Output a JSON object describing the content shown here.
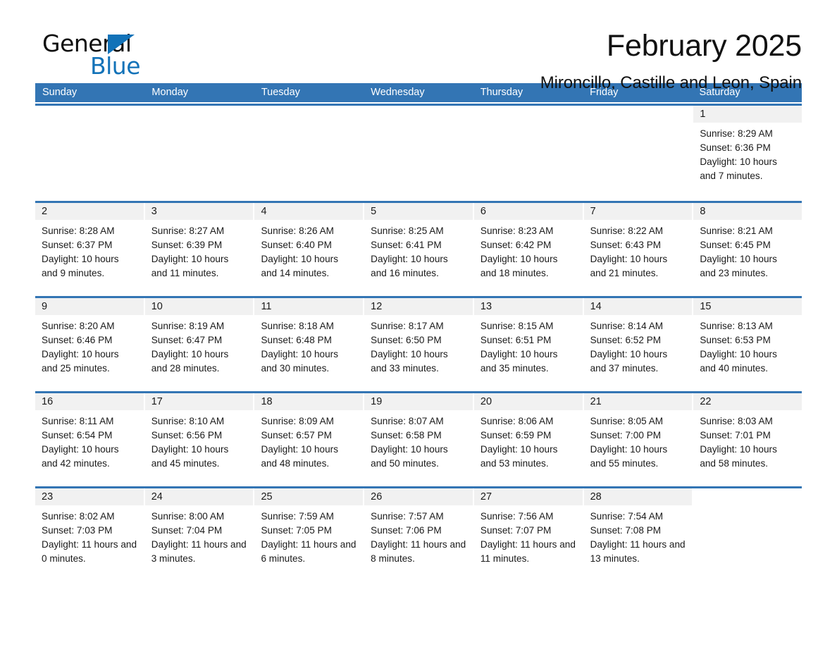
{
  "brand": {
    "name_part1": "General",
    "name_part2": "Blue",
    "accent_color": "#1272b8"
  },
  "header": {
    "month_title": "February 2025",
    "location": "Mironcillo, Castille and Leon, Spain"
  },
  "calendar": {
    "header_color": "#3375b4",
    "weekdays": [
      "Sunday",
      "Monday",
      "Tuesday",
      "Wednesday",
      "Thursday",
      "Friday",
      "Saturday"
    ],
    "weeks": [
      [
        {
          "day": "",
          "sunrise": "",
          "sunset": "",
          "daylight": "",
          "blank": true
        },
        {
          "day": "",
          "sunrise": "",
          "sunset": "",
          "daylight": "",
          "blank": true
        },
        {
          "day": "",
          "sunrise": "",
          "sunset": "",
          "daylight": "",
          "blank": true
        },
        {
          "day": "",
          "sunrise": "",
          "sunset": "",
          "daylight": "",
          "blank": true
        },
        {
          "day": "",
          "sunrise": "",
          "sunset": "",
          "daylight": "",
          "blank": true
        },
        {
          "day": "",
          "sunrise": "",
          "sunset": "",
          "daylight": "",
          "blank": true
        },
        {
          "day": "1",
          "sunrise": "Sunrise: 8:29 AM",
          "sunset": "Sunset: 6:36 PM",
          "daylight": "Daylight: 10 hours and 7 minutes."
        }
      ],
      [
        {
          "day": "2",
          "sunrise": "Sunrise: 8:28 AM",
          "sunset": "Sunset: 6:37 PM",
          "daylight": "Daylight: 10 hours and 9 minutes."
        },
        {
          "day": "3",
          "sunrise": "Sunrise: 8:27 AM",
          "sunset": "Sunset: 6:39 PM",
          "daylight": "Daylight: 10 hours and 11 minutes."
        },
        {
          "day": "4",
          "sunrise": "Sunrise: 8:26 AM",
          "sunset": "Sunset: 6:40 PM",
          "daylight": "Daylight: 10 hours and 14 minutes."
        },
        {
          "day": "5",
          "sunrise": "Sunrise: 8:25 AM",
          "sunset": "Sunset: 6:41 PM",
          "daylight": "Daylight: 10 hours and 16 minutes."
        },
        {
          "day": "6",
          "sunrise": "Sunrise: 8:23 AM",
          "sunset": "Sunset: 6:42 PM",
          "daylight": "Daylight: 10 hours and 18 minutes."
        },
        {
          "day": "7",
          "sunrise": "Sunrise: 8:22 AM",
          "sunset": "Sunset: 6:43 PM",
          "daylight": "Daylight: 10 hours and 21 minutes."
        },
        {
          "day": "8",
          "sunrise": "Sunrise: 8:21 AM",
          "sunset": "Sunset: 6:45 PM",
          "daylight": "Daylight: 10 hours and 23 minutes."
        }
      ],
      [
        {
          "day": "9",
          "sunrise": "Sunrise: 8:20 AM",
          "sunset": "Sunset: 6:46 PM",
          "daylight": "Daylight: 10 hours and 25 minutes."
        },
        {
          "day": "10",
          "sunrise": "Sunrise: 8:19 AM",
          "sunset": "Sunset: 6:47 PM",
          "daylight": "Daylight: 10 hours and 28 minutes."
        },
        {
          "day": "11",
          "sunrise": "Sunrise: 8:18 AM",
          "sunset": "Sunset: 6:48 PM",
          "daylight": "Daylight: 10 hours and 30 minutes."
        },
        {
          "day": "12",
          "sunrise": "Sunrise: 8:17 AM",
          "sunset": "Sunset: 6:50 PM",
          "daylight": "Daylight: 10 hours and 33 minutes."
        },
        {
          "day": "13",
          "sunrise": "Sunrise: 8:15 AM",
          "sunset": "Sunset: 6:51 PM",
          "daylight": "Daylight: 10 hours and 35 minutes."
        },
        {
          "day": "14",
          "sunrise": "Sunrise: 8:14 AM",
          "sunset": "Sunset: 6:52 PM",
          "daylight": "Daylight: 10 hours and 37 minutes."
        },
        {
          "day": "15",
          "sunrise": "Sunrise: 8:13 AM",
          "sunset": "Sunset: 6:53 PM",
          "daylight": "Daylight: 10 hours and 40 minutes."
        }
      ],
      [
        {
          "day": "16",
          "sunrise": "Sunrise: 8:11 AM",
          "sunset": "Sunset: 6:54 PM",
          "daylight": "Daylight: 10 hours and 42 minutes."
        },
        {
          "day": "17",
          "sunrise": "Sunrise: 8:10 AM",
          "sunset": "Sunset: 6:56 PM",
          "daylight": "Daylight: 10 hours and 45 minutes."
        },
        {
          "day": "18",
          "sunrise": "Sunrise: 8:09 AM",
          "sunset": "Sunset: 6:57 PM",
          "daylight": "Daylight: 10 hours and 48 minutes."
        },
        {
          "day": "19",
          "sunrise": "Sunrise: 8:07 AM",
          "sunset": "Sunset: 6:58 PM",
          "daylight": "Daylight: 10 hours and 50 minutes."
        },
        {
          "day": "20",
          "sunrise": "Sunrise: 8:06 AM",
          "sunset": "Sunset: 6:59 PM",
          "daylight": "Daylight: 10 hours and 53 minutes."
        },
        {
          "day": "21",
          "sunrise": "Sunrise: 8:05 AM",
          "sunset": "Sunset: 7:00 PM",
          "daylight": "Daylight: 10 hours and 55 minutes."
        },
        {
          "day": "22",
          "sunrise": "Sunrise: 8:03 AM",
          "sunset": "Sunset: 7:01 PM",
          "daylight": "Daylight: 10 hours and 58 minutes."
        }
      ],
      [
        {
          "day": "23",
          "sunrise": "Sunrise: 8:02 AM",
          "sunset": "Sunset: 7:03 PM",
          "daylight": "Daylight: 11 hours and 0 minutes."
        },
        {
          "day": "24",
          "sunrise": "Sunrise: 8:00 AM",
          "sunset": "Sunset: 7:04 PM",
          "daylight": "Daylight: 11 hours and 3 minutes."
        },
        {
          "day": "25",
          "sunrise": "Sunrise: 7:59 AM",
          "sunset": "Sunset: 7:05 PM",
          "daylight": "Daylight: 11 hours and 6 minutes."
        },
        {
          "day": "26",
          "sunrise": "Sunrise: 7:57 AM",
          "sunset": "Sunset: 7:06 PM",
          "daylight": "Daylight: 11 hours and 8 minutes."
        },
        {
          "day": "27",
          "sunrise": "Sunrise: 7:56 AM",
          "sunset": "Sunset: 7:07 PM",
          "daylight": "Daylight: 11 hours and 11 minutes."
        },
        {
          "day": "28",
          "sunrise": "Sunrise: 7:54 AM",
          "sunset": "Sunset: 7:08 PM",
          "daylight": "Daylight: 11 hours and 13 minutes."
        },
        {
          "day": "",
          "sunrise": "",
          "sunset": "",
          "daylight": "",
          "blank": true
        }
      ]
    ]
  }
}
